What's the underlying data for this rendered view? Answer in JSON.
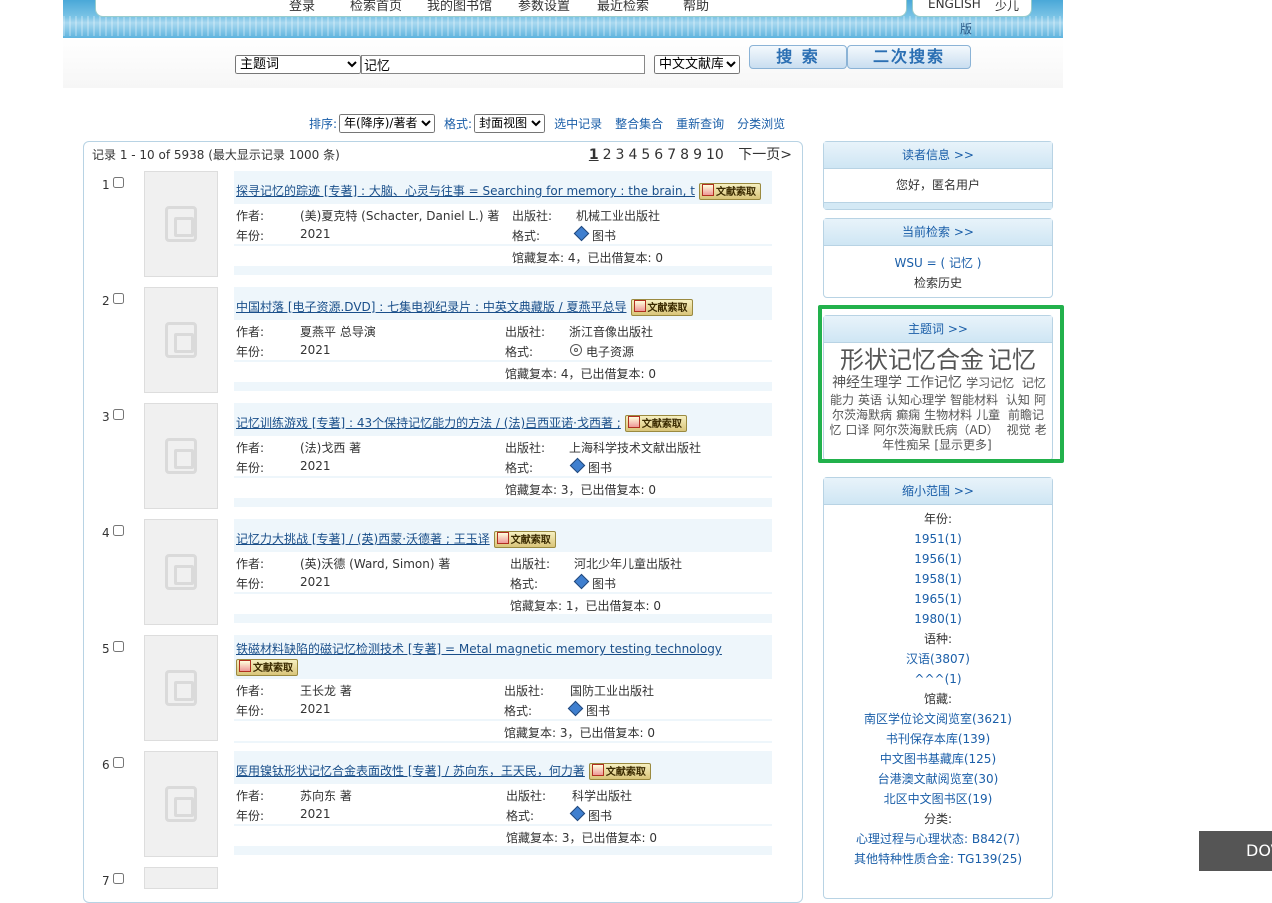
{
  "nav": {
    "items": [
      "登录",
      "检索首页",
      "我的图书馆",
      "参数设置",
      "最近检索",
      "帮助"
    ],
    "english": "ENGLISH",
    "kids": "少儿",
    "kids_suffix": "版"
  },
  "search": {
    "field_selected": "主题词",
    "query": "记忆",
    "library_selected": "中文文献库",
    "search_button": "搜 索",
    "second_search_button": "二次搜索"
  },
  "sort": {
    "label": "排序:",
    "sort_selected": "年(降序)/著者",
    "format_label": "格式:",
    "format_selected": "封面视图",
    "links": [
      "选中记录",
      "整合集合",
      "重新查询",
      "分类浏览"
    ]
  },
  "results": {
    "summary": "记录 1 - 10 of 5938 (最大显示记录 1000 条)",
    "pages": [
      "1",
      "2",
      "3",
      "4",
      "5",
      "6",
      "7",
      "8",
      "9",
      "10"
    ],
    "next_label": "下一页>",
    "request_label": "文献索取",
    "labels": {
      "author": "作者:",
      "year": "年份:",
      "publisher": "出版社:",
      "format": "格式:"
    },
    "records": [
      {
        "num": "1",
        "title": "探寻记忆的踪迹 [专著] : 大脑、心灵与往事 = Searching for memory : the brain, t",
        "author": "(美)夏克特 (Schacter, Daniel L.) 著",
        "year": "2021",
        "publisher": "机械工业出版社",
        "format": "图书",
        "holdings": "馆藏复本: 4，已出借复本: 0"
      },
      {
        "num": "2",
        "title": "中国村落 [电子资源.DVD] : 七集电视纪录片 : 中英文典藏版 / 夏燕平总导",
        "author": "夏燕平 总导演",
        "year": "2021",
        "publisher": "浙江音像出版社",
        "format": "电子资源",
        "holdings": "馆藏复本: 4，已出借复本: 0"
      },
      {
        "num": "3",
        "title": "记忆训练游戏 [专著] : 43个保持记忆能力的方法 / (法)吕西亚诺·戈西著 ;",
        "author": "(法)戈西 著",
        "year": "2021",
        "publisher": "上海科学技术文献出版社",
        "format": "图书",
        "holdings": "馆藏复本: 3，已出借复本: 0"
      },
      {
        "num": "4",
        "title": "记忆力大挑战 [专著] / (英)西蒙·沃德著 ; 王玉译",
        "author": "(英)沃德 (Ward, Simon) 著",
        "year": "2021",
        "publisher": "河北少年儿童出版社",
        "format": "图书",
        "holdings": "馆藏复本: 1，已出借复本: 0"
      },
      {
        "num": "5",
        "title": "铁磁材料缺陷的磁记忆检测技术 [专著] = Metal magnetic memory testing technology",
        "author": "王长龙 著",
        "year": "2021",
        "publisher": "国防工业出版社",
        "format": "图书",
        "holdings": "馆藏复本: 3，已出借复本: 0"
      },
      {
        "num": "6",
        "title": "医用镍钛形状记忆合金表面改性 [专著] / 苏向东，王天民，何力著",
        "author": "苏向东 著",
        "year": "2021",
        "publisher": "科学出版社",
        "format": "图书",
        "holdings": "馆藏复本: 3，已出借复本: 0"
      },
      {
        "num": "7"
      }
    ]
  },
  "reader_panel": {
    "title": "读者信息 >>",
    "greeting": "您好，匿名用户"
  },
  "current_search_panel": {
    "title": "当前检索 >>",
    "query": "WSU = ( 记忆 )",
    "history": "检索历史"
  },
  "subject_panel": {
    "title": "主题词 >>",
    "tags_big": [
      "形状记忆合金",
      "记忆"
    ],
    "tags_mid": [
      "神经生理学",
      "工作记忆"
    ],
    "tags_small": [
      "学习记忆",
      "记忆能力",
      "英语",
      "认知心理学",
      "智能材料",
      "认知",
      "阿尔茨海默病",
      "癫痫",
      "生物材料",
      "儿童",
      "前瞻记忆",
      "口译",
      "阿尔茨海默氏病（AD）",
      "视觉",
      "老年性痴呆"
    ],
    "more": "[显示更多]"
  },
  "narrow_panel": {
    "title": "缩小范围 >>",
    "year_label": "年份:",
    "years": [
      "1951(1)",
      "1956(1)",
      "1958(1)",
      "1965(1)",
      "1980(1)"
    ],
    "lang_label": "语种:",
    "langs": [
      "汉语(3807)",
      "^^^(1)"
    ],
    "loc_label": "馆藏:",
    "locations": [
      "南区学位论文阅览室(3621)",
      "书刊保存本库(139)",
      "中文图书基藏库(125)",
      "台港澳文献阅览室(30)",
      "北区中文图书区(19)"
    ],
    "class_label": "分类:",
    "classes": [
      "心理过程与心理状态: B842(7)",
      "其他特种性质合金: TG139(25)"
    ]
  },
  "download_tab": "DOV"
}
